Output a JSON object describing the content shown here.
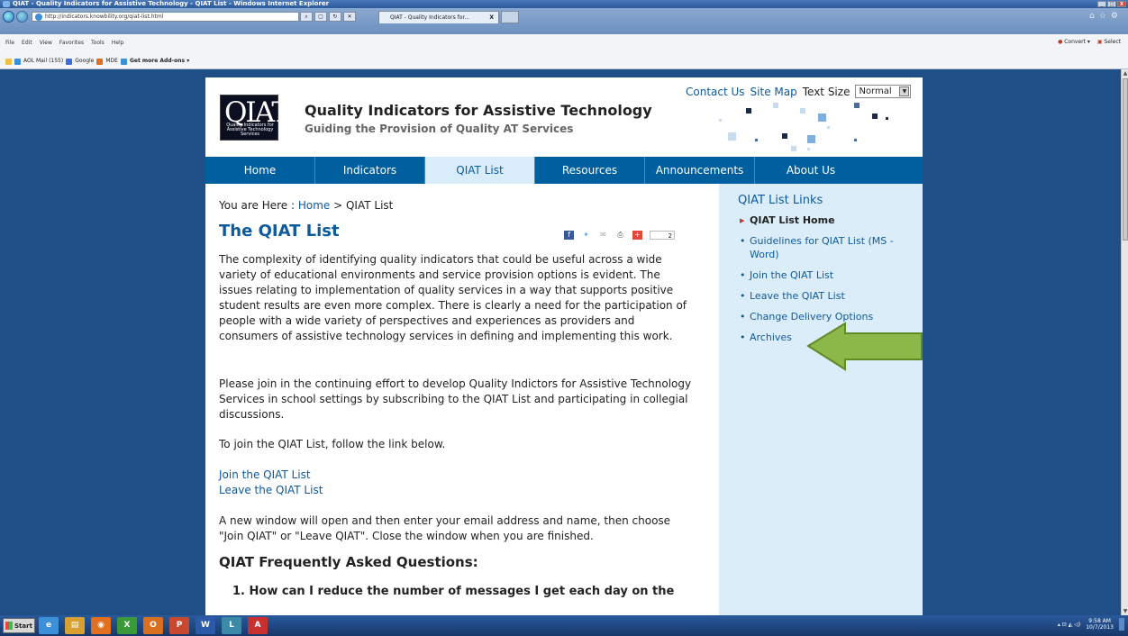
{
  "window": {
    "title": "QIAT - Quality Indicators for Assistive Technology - QIAT List - Windows Internet Explorer",
    "controls": [
      "_",
      "□",
      "X"
    ]
  },
  "browser": {
    "address": "http://indicators.knowbility.org/qiat-list.html",
    "tab_label": "QIAT - Quality Indicators for...",
    "tab_close": "X",
    "menu": [
      "File",
      "Edit",
      "View",
      "Favorites",
      "Tools",
      "Help"
    ],
    "favorites": [
      "AOL Mail (155)",
      "Google",
      "MDE",
      "Get more Add-ons ▾"
    ],
    "tools": [
      "Convert ▾",
      "Select"
    ]
  },
  "site": {
    "logo_text": "QIAT",
    "logo_caption": "Quality Indicators for Assistive Technology Services",
    "title": "Quality Indicators for Assistive Technology",
    "subtitle": "Guiding the Provision of Quality AT Services",
    "utility": {
      "contact": "Contact Us",
      "sitemap": "Site Map",
      "textsize_label": "Text Size",
      "textsize_value": "Normal"
    },
    "nav": [
      "Home",
      "Indicators",
      "QIAT List",
      "Resources",
      "Announcements",
      "About Us"
    ]
  },
  "main": {
    "breadcrumb_prefix": "You are Here : ",
    "breadcrumb_home": "Home",
    "breadcrumb_sep": " > ",
    "breadcrumb_current": "QIAT List",
    "heading": "The QIAT List",
    "share_count": "2",
    "para1": "The complexity of identifying quality indicators that could be useful across a wide variety of educational environments and service provision options is evident. The issues relating to implementation of quality services in a way that supports positive student results are even more complex. There is clearly a need for the participation of people with a wide variety of perspectives and experiences as providers and consumers of assistive technology services in defining and implementing this work.",
    "para2": "Please join in the continuing effort to develop Quality Indictors for Assistive Technology Services in school settings by subscribing to the QIAT List and participating in collegial discussions.",
    "para3": "To join the QIAT List, follow the link below.",
    "link_join": "Join the QIAT List",
    "link_leave": "Leave the QIAT List",
    "para4": "A new window will open and then enter your email address and name, then choose \"Join QIAT\" or \"Leave QIAT\". Close the window when you are finished.",
    "faq_heading": "QIAT Frequently Asked Questions:",
    "faq1": "1. How can I reduce the number of messages I get each day on the"
  },
  "sidebar": {
    "title": "QIAT List Links",
    "items": [
      "QIAT List Home",
      "Guidelines for QIAT List (MS - Word)",
      "Join the QIAT List",
      "Leave the QIAT List",
      "Change Delivery Options",
      "Archives"
    ]
  },
  "taskbar": {
    "start": "Start",
    "time": "9:58 AM",
    "date": "10/7/2013"
  },
  "colors": {
    "nav_bg": "#005f9e",
    "link": "#0e5a9c",
    "sidebar_bg": "#dbedf9",
    "arrow": "#8cb84a"
  }
}
